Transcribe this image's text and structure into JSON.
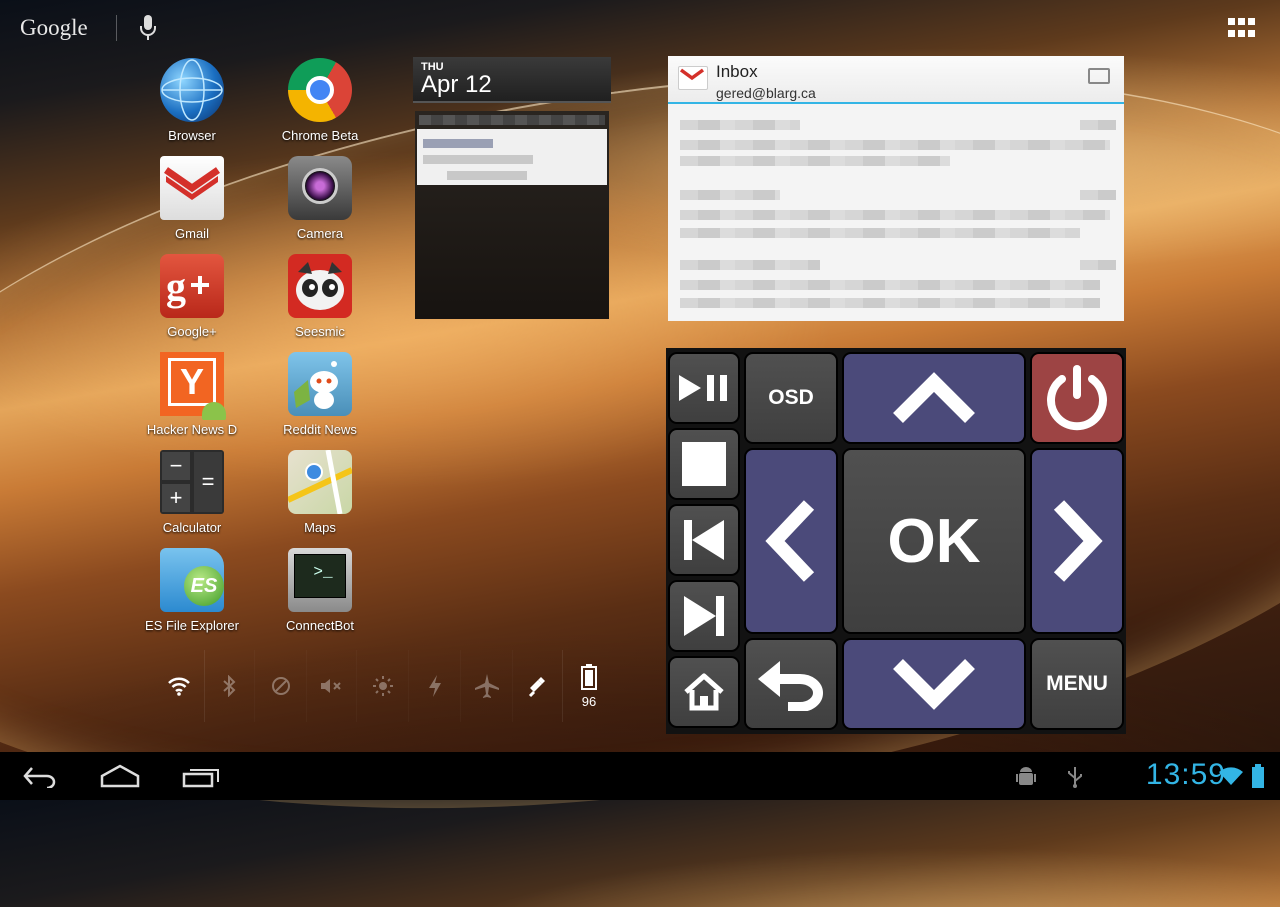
{
  "search": {
    "logo_text": "Google"
  },
  "apps": [
    {
      "label": "Browser",
      "icon": "globe-icon"
    },
    {
      "label": "Chrome Beta",
      "icon": "chrome-icon"
    },
    {
      "label": "Gmail",
      "icon": "gmail-icon"
    },
    {
      "label": "Camera",
      "icon": "camera-icon"
    },
    {
      "label": "Google+",
      "icon": "google-plus-icon"
    },
    {
      "label": "Seesmic",
      "icon": "seesmic-icon"
    },
    {
      "label": "Hacker News D",
      "icon": "hacker-news-icon"
    },
    {
      "label": "Reddit News",
      "icon": "reddit-icon"
    },
    {
      "label": "Calculator",
      "icon": "calculator-icon"
    },
    {
      "label": "Maps",
      "icon": "maps-icon"
    },
    {
      "label": "ES File Explorer",
      "icon": "folder-icon"
    },
    {
      "label": "ConnectBot",
      "icon": "terminal-icon"
    }
  ],
  "calendar": {
    "day_of_week": "THU",
    "date": "Apr 12"
  },
  "gmail": {
    "title": "Inbox",
    "account": "gered@blarg.ca"
  },
  "remote": {
    "osd_label": "OSD",
    "ok_label": "OK",
    "menu_label": "MENU",
    "colors": {
      "gray": "#474747",
      "blue": "#4b4a7a",
      "red": "#9d4444"
    }
  },
  "power_control": {
    "battery_level": "96"
  },
  "status": {
    "time": "13:59",
    "accent": "#33b5e5"
  }
}
